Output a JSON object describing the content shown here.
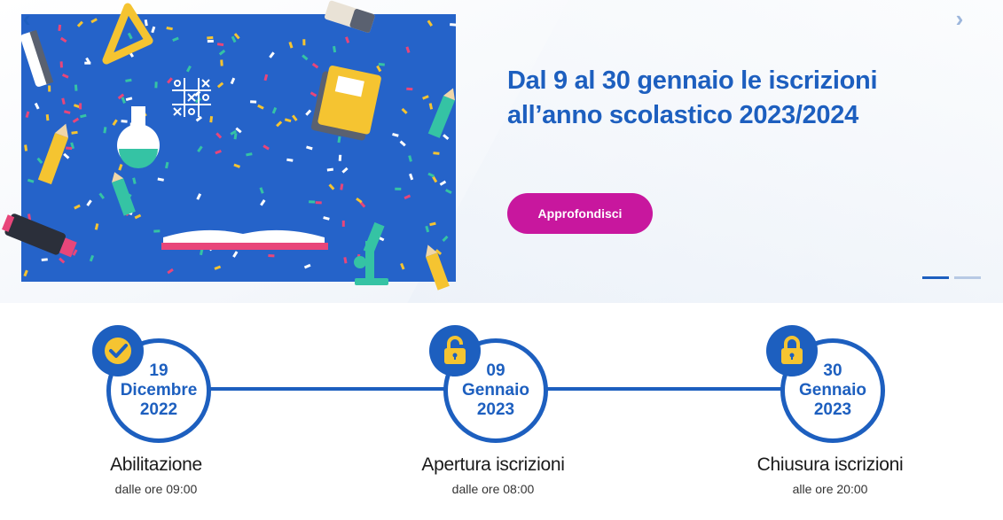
{
  "carousel": {
    "prev_icon": "chevron-left-icon",
    "next_icon": "chevron-right-icon",
    "prev_glyph": "‹",
    "next_glyph": "›",
    "headline_line1": "Dal 9 al 30 gennaio le iscrizioni",
    "headline_line2": "all’anno scolastico 2023/2024",
    "cta_label": "Approfondisci",
    "slides_count": 2,
    "active_slide": 1
  },
  "timeline": {
    "steps": [
      {
        "day": "19",
        "month": "Dicembre",
        "year": "2022",
        "icon": "check-icon",
        "title": "Abilitazione",
        "subtitle": "dalle ore 09:00"
      },
      {
        "day": "09",
        "month": "Gennaio",
        "year": "2023",
        "icon": "unlocked-padlock-icon",
        "title": "Apertura iscrizioni",
        "subtitle": "dalle ore 08:00"
      },
      {
        "day": "30",
        "month": "Gennaio",
        "year": "2023",
        "icon": "locked-padlock-icon",
        "title": "Chiusura iscrizioni",
        "subtitle": "alle ore 20:00"
      }
    ]
  },
  "colors": {
    "primary": "#1d5fbf",
    "accent": "#c8179e",
    "badge_icon": "#f5c431",
    "illustration_bg": "#2563c9"
  }
}
